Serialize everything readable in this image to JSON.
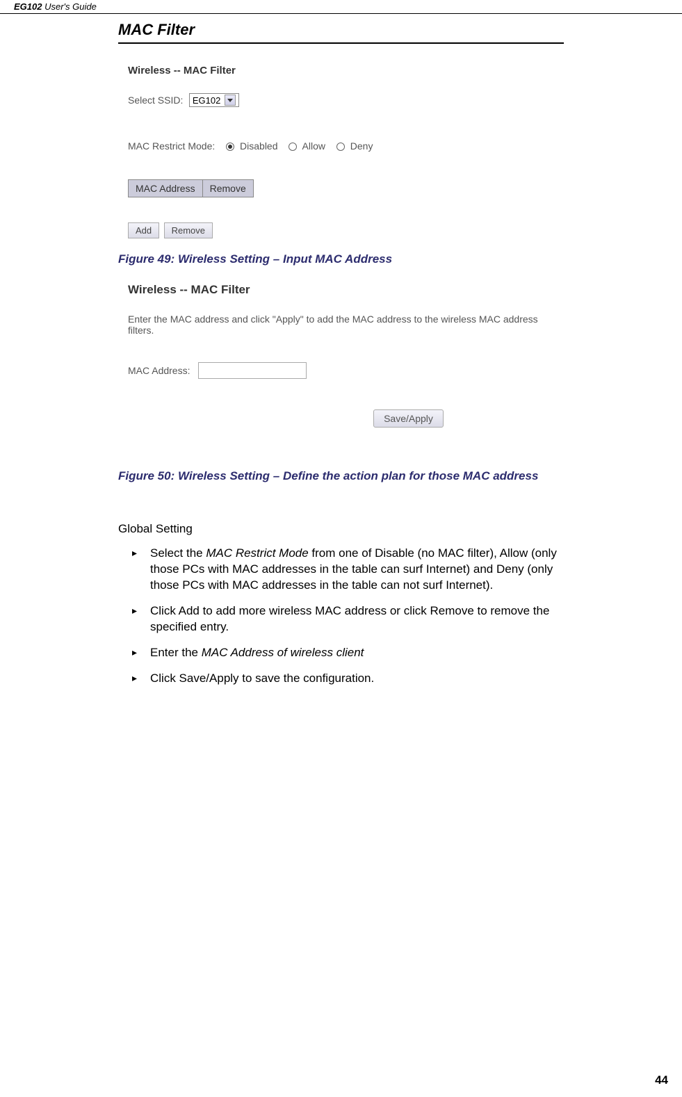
{
  "header": {
    "product": "EG102",
    "suffix": " User's Guide"
  },
  "section_title": "MAC Filter",
  "screenshot1": {
    "title": "Wireless -- MAC Filter",
    "ssid_label": "Select SSID:",
    "ssid_value": "EG102",
    "restrict_label": "MAC Restrict Mode:",
    "options": {
      "disabled": "Disabled",
      "allow": "Allow",
      "deny": "Deny"
    },
    "table": {
      "col1": "MAC Address",
      "col2": "Remove"
    },
    "buttons": {
      "add": "Add",
      "remove": "Remove"
    }
  },
  "figure49": "Figure 49: Wireless Setting – Input MAC Address",
  "screenshot2": {
    "title": "Wireless -- MAC Filter",
    "instruction": "Enter the MAC address and click \"Apply\" to add the MAC address to the wireless MAC address filters.",
    "mac_label": "MAC Address:",
    "save_btn": "Save/Apply"
  },
  "figure50": "Figure 50: Wireless Setting – Define the action plan for those MAC address",
  "global_heading": "Global Setting",
  "bullets": {
    "b1_pre": "Select the ",
    "b1_italic": "MAC Restrict Mode",
    "b1_post": " from one of Disable (no MAC filter), Allow (only those PCs with MAC addresses in the table can surf Internet) and Deny (only those PCs with MAC addresses in the table can not surf Internet).",
    "b2": "Click Add to add more wireless MAC address or click Remove to remove the specified entry.",
    "b3_pre": "Enter the ",
    "b3_italic": "MAC Address of wireless client",
    "b4": "Click Save/Apply to save the configuration."
  },
  "page_number": "44"
}
